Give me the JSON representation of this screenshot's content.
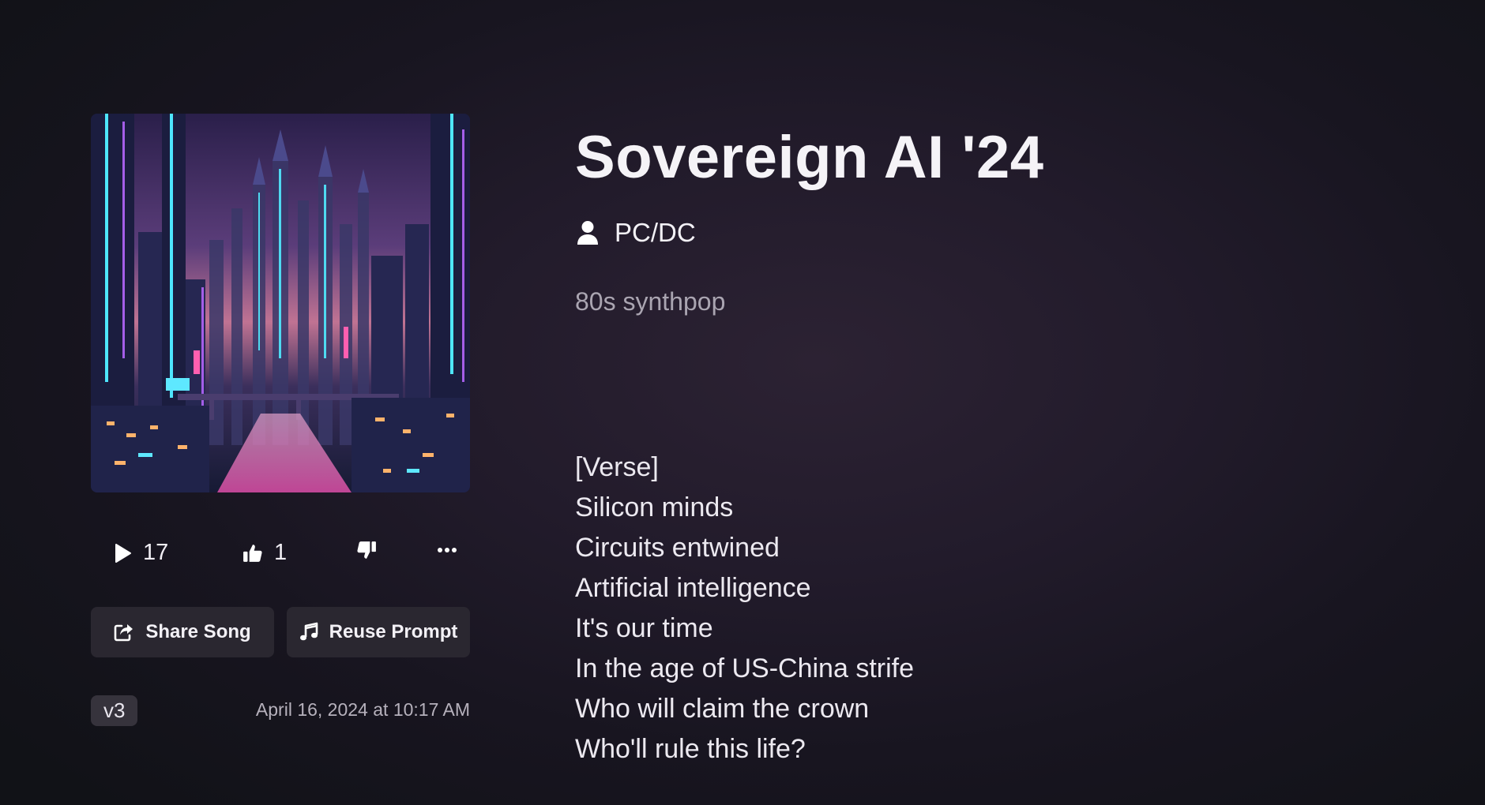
{
  "song": {
    "title": "Sovereign AI '24",
    "artist": "PC/DC",
    "style": "80s synthpop",
    "version": "v3",
    "created_at": "April 16, 2024 at 10:17 AM"
  },
  "stats": {
    "plays": "17",
    "likes": "1"
  },
  "actions": {
    "share_label": "Share Song",
    "reuse_label": "Reuse Prompt"
  },
  "icons": {
    "play": "play-icon",
    "like": "thumbs-up-icon",
    "dislike": "thumbs-down-icon",
    "more": "more-horizontal-icon",
    "share": "share-icon",
    "reuse": "music-note-icon",
    "artist": "user-icon"
  },
  "colors": {
    "background": "#221b2b",
    "button_bg": "#2a2730",
    "badge_bg": "#36333c",
    "text": "#f5f3f7",
    "muted_text": "#aaa5b1"
  },
  "lyrics": [
    "[Verse]",
    "Silicon minds",
    "Circuits entwined",
    "Artificial intelligence",
    "It's our time",
    "In the age of US-China strife",
    "Who will claim the crown",
    "Who'll rule this life?"
  ]
}
